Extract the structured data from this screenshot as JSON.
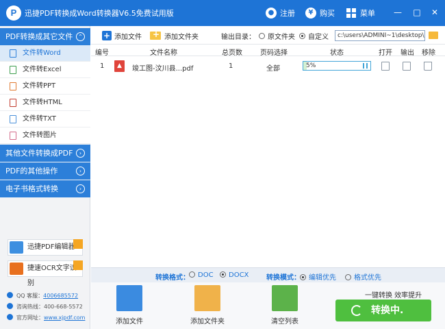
{
  "app": {
    "logo_letter": "P",
    "title": "迅捷PDF转换成Word转换器V6.5免费试用版",
    "register": "注册",
    "buy": "购买",
    "menu": "菜单",
    "buy_glyph": "¥"
  },
  "sidebar": {
    "category_main": "PDF转换成其它文件",
    "items": [
      "文件转Word",
      "文件转Excel",
      "文件转PPT",
      "文件转HTML",
      "文件转TXT",
      "文件转图片"
    ],
    "category_other": "其他文件转换成PDF",
    "category_ops": "PDF的其他操作",
    "category_ebook": "电子书格式转换",
    "promo_editor": "迅捷PDF编辑器",
    "promo_ocr": "捷速OCR文字识别",
    "contact": {
      "qq_label": "QQ 客服：",
      "qq": "4006685572",
      "hotline_label": "咨询热线：",
      "hotline": "400-668-5572",
      "site_label": "官方网址：",
      "site": "www.xjpdf.com"
    }
  },
  "toolbar": {
    "add_file": "添加文件",
    "add_folder": "添加文件夹",
    "output_label": "输出目录：",
    "output_original": "原文件夹",
    "output_custom": "自定义",
    "output_path": "c:\\users\\ADMINI~1\\desktop\\"
  },
  "table": {
    "headers": {
      "index": "编号",
      "name": "文件名称",
      "pages": "总页数",
      "range": "页码选择",
      "status": "状态",
      "open": "打开",
      "output": "输出",
      "remove": "移除"
    },
    "rows": [
      {
        "index": "1",
        "name": "竣工图-汶川县...pdf",
        "pages": "1",
        "range": "全部",
        "progress_text": "5%",
        "progress": 0.05
      }
    ]
  },
  "format_bar": {
    "format_label": "转换格式：",
    "doc": "DOC",
    "docx": "DOCX",
    "mode_label": "转换模式：",
    "mode_edit": "编辑优先",
    "mode_format": "格式优先"
  },
  "bottom": {
    "add_file": "添加文件",
    "add_folder": "添加文件夹",
    "clear_list": "清空列表",
    "slogan": "一键转换  效率提升",
    "convert": "转换中."
  },
  "colors": {
    "brand_blue": "#1e74d6",
    "convert_green": "#4fbf3f"
  }
}
